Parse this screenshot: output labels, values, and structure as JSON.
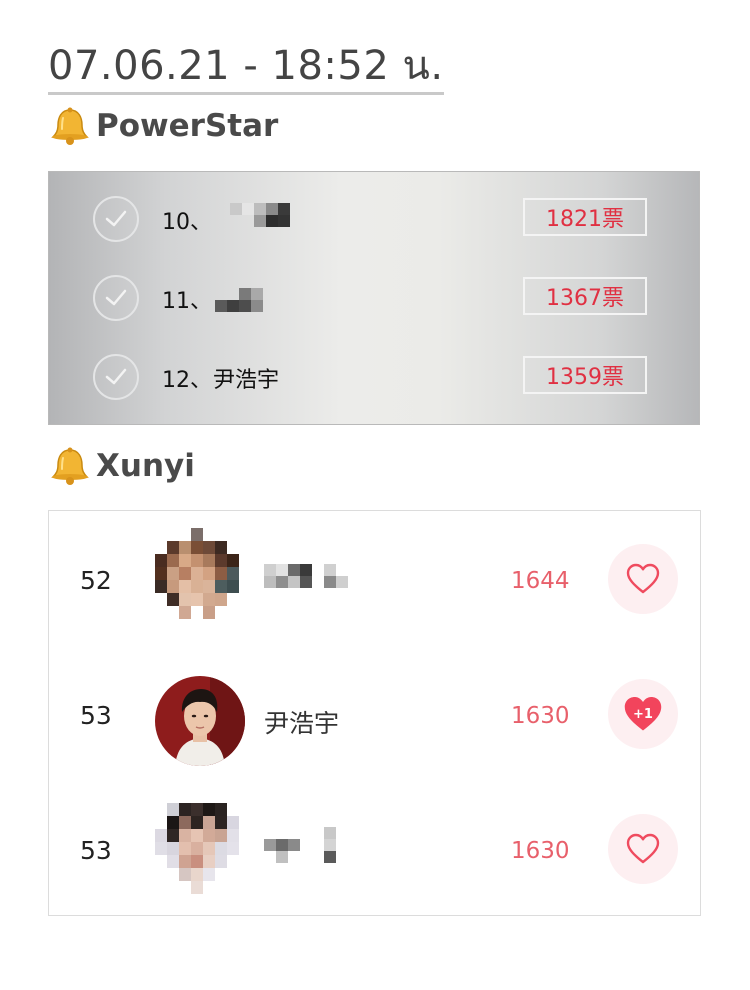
{
  "header": {
    "datetime": "07.06.21 - 18:52 น."
  },
  "sections": {
    "powerstar": {
      "title": "PowerStar",
      "icon": "bell-icon",
      "rows": [
        {
          "rank": "10、",
          "name": "",
          "name_hidden": true,
          "votes": "1821票"
        },
        {
          "rank": "11、",
          "name": "",
          "name_hidden": true,
          "votes": "1367票"
        },
        {
          "rank": "12、",
          "name": "尹浩宇",
          "name_hidden": false,
          "votes": "1359票"
        }
      ]
    },
    "xunyi": {
      "title": "Xunyi",
      "icon": "bell-icon",
      "rows": [
        {
          "rank": "52",
          "name": "",
          "name_hidden": true,
          "score": "1644",
          "liked": false
        },
        {
          "rank": "53",
          "name": "尹浩宇",
          "name_hidden": false,
          "score": "1630",
          "liked": true,
          "like_badge": "+1"
        },
        {
          "rank": "53",
          "name": "",
          "name_hidden": true,
          "score": "1630",
          "liked": false
        }
      ]
    }
  },
  "colors": {
    "vote_red": "#e03042",
    "score_pink": "#e8606b",
    "heart_bg": "#fdeff1",
    "heart_filled": "#f2445c"
  }
}
